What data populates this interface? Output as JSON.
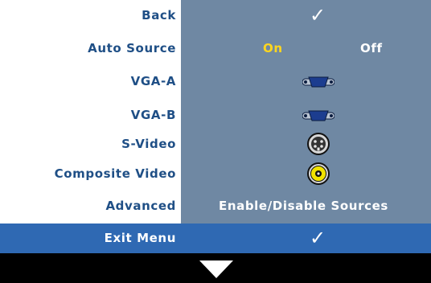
{
  "menu": {
    "rows": [
      {
        "label": "Back",
        "value": "✓"
      },
      {
        "label": "Auto Source",
        "on": "On",
        "off": "Off"
      },
      {
        "label": "VGA-A",
        "icon": "vga-port-icon"
      },
      {
        "label": "VGA-B",
        "icon": "vga-port-icon"
      },
      {
        "label": "S-Video",
        "icon": "s-video-port-icon"
      },
      {
        "label": "Composite Video",
        "icon": "composite-video-port-icon"
      },
      {
        "label": "Advanced",
        "value": "Enable/Disable Sources"
      }
    ],
    "exit": {
      "label": "Exit Menu",
      "value": "✓"
    },
    "footer": {
      "icon": "down-arrow-icon"
    }
  },
  "colors": {
    "label_text": "#1f4f86",
    "value_panel": "#6f88a3",
    "on_text": "#ffd61f",
    "exit_bar": "#2f69b3",
    "footer_bar": "#000000"
  }
}
